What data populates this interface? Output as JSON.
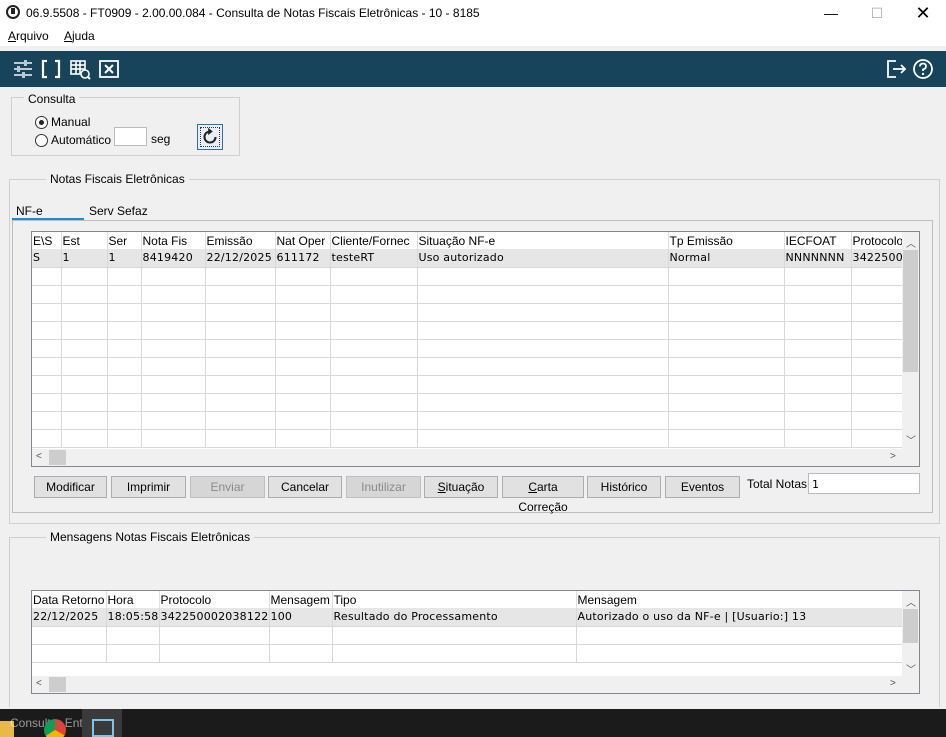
{
  "window": {
    "title": "06.9.5508 - FT0909 - 2.00.00.084 - Consulta de Notas Fiscais Eletrônicas - 10 - 8185",
    "minimize": "—",
    "maximize": "☐",
    "close": "✕"
  },
  "menu": {
    "arquivo_u": "A",
    "arquivo_rest": "rquivo",
    "ajuda_u": "A",
    "ajuda_rest": "juda"
  },
  "toolbar": {
    "icons": [
      "sliders-icon",
      "brackets-icon",
      "grid-view-icon",
      "close-box-icon",
      "exit-icon",
      "help-icon"
    ]
  },
  "consulta": {
    "title": "Consulta",
    "manual": "Manual",
    "automatico": "Automático",
    "seg": "seg",
    "selected": "Manual"
  },
  "nfe_group": {
    "title": "Notas Fiscais Eletrônicas",
    "tabs": [
      "NF-e",
      "Serv Sefaz"
    ],
    "columns": [
      "E\\S",
      "Est",
      "Ser",
      "Nota Fis",
      "Emissão",
      "Nat Oper",
      "Cliente/Fornec",
      "Situação NF-e",
      "Tp Emissão",
      "IECFOAT",
      "Protocolo"
    ],
    "rows": [
      [
        "S",
        "1",
        "1",
        "8419420",
        "22/12/2025",
        "611172",
        "testeRT",
        "Uso autorizado",
        "Normal",
        "NNNNNNN",
        "3422500"
      ]
    ],
    "buttons": {
      "modificar": "Modificar",
      "imprimir": "Imprimir",
      "enviar": "Enviar",
      "cancelar": "Cancelar",
      "inutilizar": "Inutilizar",
      "situacao_u": "S",
      "situacao_rest": "ituação",
      "carta_u": "C",
      "carta_rest": "arta Correção",
      "historico": "Histórico",
      "eventos": "Eventos"
    },
    "total_label": "Total Notas:",
    "total_value": "1"
  },
  "msg_group": {
    "title": "Mensagens Notas Fiscais Eletrônicas",
    "columns": [
      "Data Retorno",
      "Hora",
      "Protocolo",
      "Mensagem",
      "Tipo",
      "Mensagem"
    ],
    "rows": [
      [
        "22/12/2025",
        "18:05:58",
        "342250002038122",
        "100",
        "Resultado do Processamento",
        "Autorizado o uso da NF-e | [Usuario:] 13"
      ]
    ]
  },
  "taskbar": {
    "text": "Consultar Entradas"
  },
  "colors": {
    "toolbar_bg": "#17445a",
    "tab_underline": "#1a8fd0"
  }
}
